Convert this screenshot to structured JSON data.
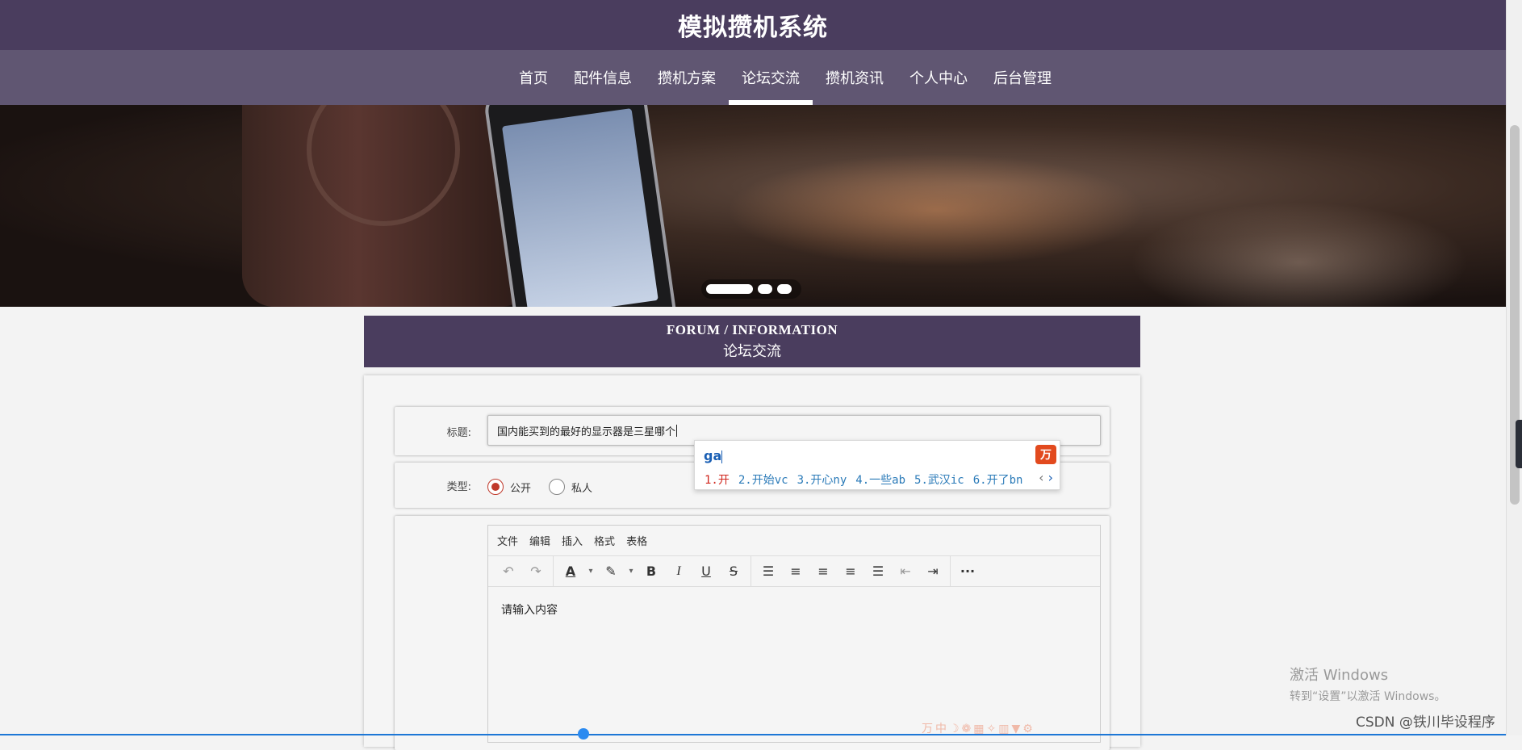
{
  "site": {
    "title": "模拟攒机系统"
  },
  "nav": {
    "items": [
      "首页",
      "配件信息",
      "攒机方案",
      "论坛交流",
      "攒机资讯",
      "个人中心",
      "后台管理"
    ],
    "active": "论坛交流"
  },
  "forum": {
    "title_en": "FORUM / INFORMATION",
    "title_cn": "论坛交流"
  },
  "form": {
    "title_label": "标题:",
    "title_value": "国内能买到的最好的显示器是三星哪个",
    "type_label": "类型:",
    "type_options": [
      "公开",
      "私人"
    ],
    "type_selected": "公开"
  },
  "ime": {
    "composition": "ga",
    "candidates": [
      "1.开",
      "2.开始vc",
      "3.开心ny",
      "4.一些ab",
      "5.武汉ic",
      "6.开了bn"
    ]
  },
  "editor": {
    "menus": [
      "文件",
      "编辑",
      "插入",
      "格式",
      "表格"
    ],
    "placeholder": "请输入内容",
    "toolbar_icons": [
      "undo-icon",
      "redo-icon",
      "text-color-icon",
      "highlight-icon",
      "bold-icon",
      "italic-icon",
      "underline-icon",
      "strikethrough-icon",
      "bullet-list-icon",
      "align-left-icon",
      "align-center-icon",
      "align-right-icon",
      "align-justify-icon",
      "outdent-icon",
      "indent-icon",
      "more-icon"
    ]
  },
  "watermark": {
    "activate_title": "激活 Windows",
    "activate_sub": "转到“设置”以激活 Windows。",
    "csdn": "CSDN @铁川毕设程序"
  },
  "colors": {
    "header": "#4a3d5e",
    "nav": "#605672",
    "radio_accent": "#c0392b",
    "ime_first": "#d0261d"
  }
}
